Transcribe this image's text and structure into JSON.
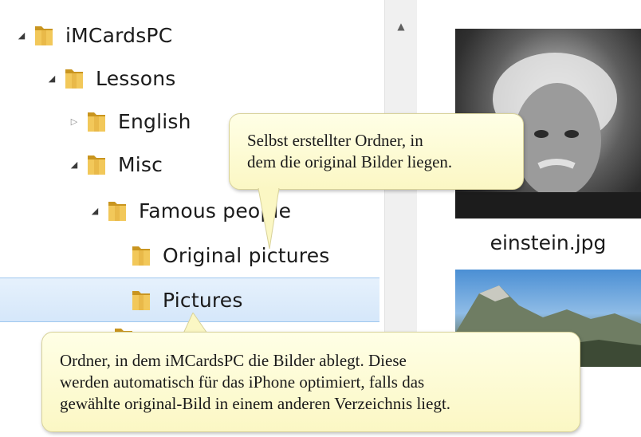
{
  "tree": {
    "items": [
      {
        "label": "iMCardsPC",
        "expander": "expanded"
      },
      {
        "label": "Lessons",
        "expander": "expanded"
      },
      {
        "label": "English",
        "expander": "collapsed"
      },
      {
        "label": "Misc",
        "expander": "expanded"
      },
      {
        "label": "Famous people",
        "expander": "expanded"
      },
      {
        "label": "Original pictures",
        "expander": "none"
      },
      {
        "label": "Pictures",
        "expander": "none",
        "selected": true
      }
    ]
  },
  "thumbnails": {
    "first_caption": "einstein.jpg"
  },
  "callouts": {
    "top_line1": "Selbst erstellter Ordner, in",
    "top_line2": "dem die original Bilder liegen.",
    "bottom_line1": "Ordner, in dem iMCardsPC die Bilder ablegt. Diese",
    "bottom_line2": "werden automatisch für das iPhone optimiert, falls das",
    "bottom_line3": "gewählte original-Bild in einem anderen Verzeichnis liegt."
  },
  "colors": {
    "selection": "#d5e7fa",
    "callout": "#fbf7c4",
    "folder": "#e9b949"
  }
}
